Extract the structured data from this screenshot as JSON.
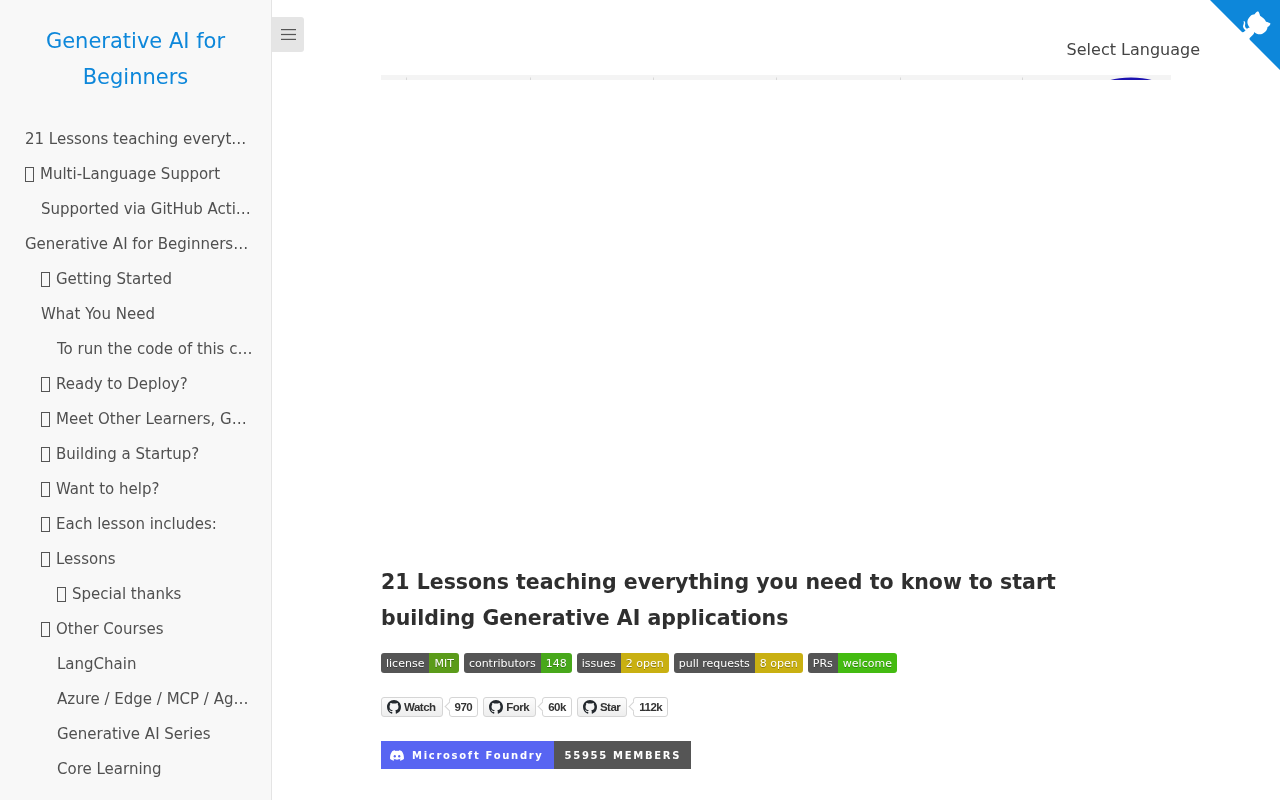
{
  "sidebar": {
    "title": "Generative AI for Beginners",
    "items": [
      {
        "label": "21 Lessons teaching everyt…",
        "glyph": false
      },
      {
        "label": "Multi-Language Support",
        "glyph": true,
        "children": [
          {
            "label": "Supported via GitHub Acti…",
            "glyph": false
          }
        ]
      },
      {
        "label": "Generative AI for Beginners…",
        "glyph": false,
        "children": [
          {
            "label": "Getting Started",
            "glyph": true
          },
          {
            "label": "What You Need",
            "glyph": false,
            "children": [
              {
                "label": "To run the code of this c…",
                "glyph": false
              }
            ]
          },
          {
            "label": "Ready to Deploy?",
            "glyph": true
          },
          {
            "label": "Meet Other Learners, G…",
            "glyph": true
          },
          {
            "label": "Building a Startup?",
            "glyph": true
          },
          {
            "label": "Want to help?",
            "glyph": true
          },
          {
            "label": "Each lesson includes:",
            "glyph": true
          },
          {
            "label": "Lessons",
            "glyph": true,
            "children": [
              {
                "label": "Special thanks",
                "glyph": true
              }
            ]
          },
          {
            "label": "Other Courses",
            "glyph": true,
            "children": [
              {
                "label": "LangChain",
                "glyph": false
              },
              {
                "label": "Azure / Edge / MCP / Ag…",
                "glyph": false
              },
              {
                "label": "Generative AI Series",
                "glyph": false
              },
              {
                "label": "Core Learning",
                "glyph": false
              }
            ]
          }
        ]
      }
    ]
  },
  "language_selector": {
    "label": "Select Language"
  },
  "article": {
    "heading": "21 Lessons teaching everything you need to know to start building Generative AI applications",
    "badges": [
      {
        "label": "license",
        "value": "MIT",
        "color": "#5b9b1a"
      },
      {
        "label": "contributors",
        "value": "148",
        "color": "#48a81b"
      },
      {
        "label": "issues",
        "value": "2 open",
        "color": "#c9b012"
      },
      {
        "label": "pull requests",
        "value": "8 open",
        "color": "#c9b012"
      },
      {
        "label": "PRs",
        "value": "welcome",
        "color": "#44bb11"
      }
    ],
    "github_buttons": [
      {
        "label": "Watch",
        "count": "970"
      },
      {
        "label": "Fork",
        "count": "60k"
      },
      {
        "label": "Star",
        "count": "112k"
      }
    ],
    "community_badge": {
      "label": "Microsoft Foundry",
      "value": "55955 MEMBERS"
    }
  }
}
